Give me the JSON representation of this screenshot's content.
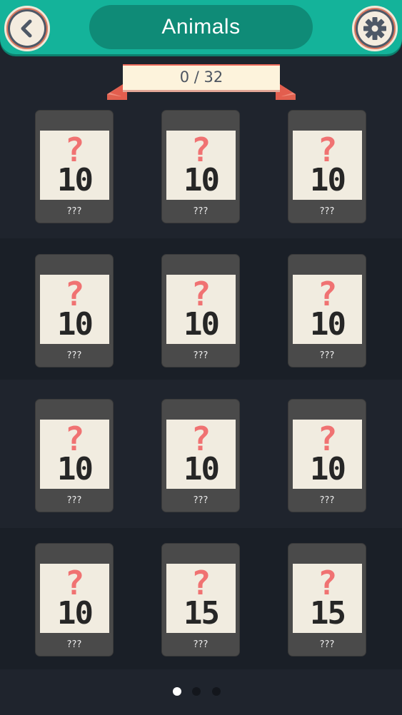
{
  "header": {
    "title": "Animals",
    "back_icon": "chevron-left-icon",
    "settings_icon": "gear-icon",
    "colors": {
      "bar": "#14b39a",
      "pill": "#0f8b77"
    }
  },
  "progress": {
    "label": "0 / 32",
    "collected": 0,
    "total": 32
  },
  "cards": [
    {
      "cost": "10",
      "name": "???"
    },
    {
      "cost": "10",
      "name": "???"
    },
    {
      "cost": "10",
      "name": "???"
    },
    {
      "cost": "10",
      "name": "???"
    },
    {
      "cost": "10",
      "name": "???"
    },
    {
      "cost": "10",
      "name": "???"
    },
    {
      "cost": "10",
      "name": "???"
    },
    {
      "cost": "10",
      "name": "???"
    },
    {
      "cost": "10",
      "name": "???"
    },
    {
      "cost": "10",
      "name": "???"
    },
    {
      "cost": "15",
      "name": "???"
    },
    {
      "cost": "15",
      "name": "???"
    }
  ],
  "locked_symbol": "?",
  "pagination": {
    "pages": 3,
    "current": 1
  }
}
